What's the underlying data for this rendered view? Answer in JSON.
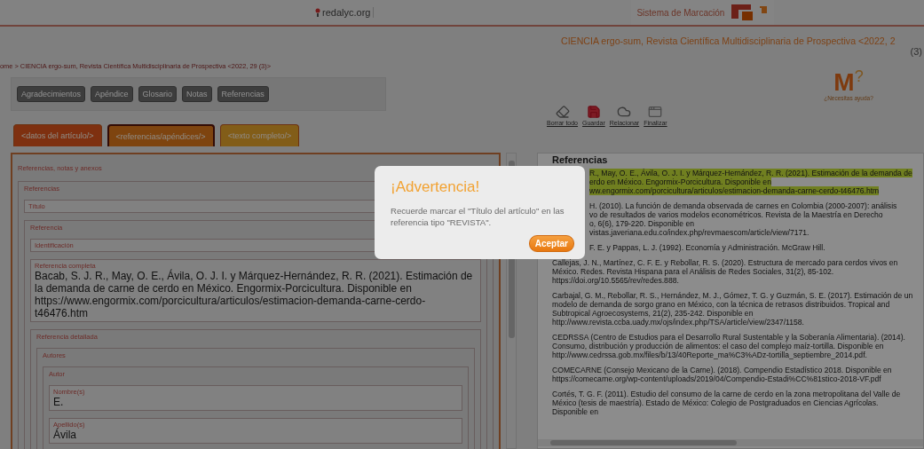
{
  "header": {
    "site_logo": "redalyc.org",
    "system_logo": "Sistema de Marcación"
  },
  "journal_title": "CIENCIA ergo-sum, Revista Científica Multidisciplinaria de Prospectiva <2022, 2",
  "journal_issue": "(3)",
  "breadcrumb": "ome > CIENCIA ergo-sum, Revista Científica Multidisciplinaria de Prospectiva <2022, 29 (3)>",
  "section_buttons": [
    "Agradecimientos",
    "Apéndice",
    "Glosario",
    "Notas",
    "Referencias"
  ],
  "help": {
    "letter": "M",
    "mark": "?",
    "caption": "¿Necesitas ayuda?"
  },
  "tabs": [
    {
      "label": "<datos del artículo/>",
      "selected": false
    },
    {
      "label": "<referencias/apéndices/>",
      "selected": true
    },
    {
      "label": "<texto completo/>",
      "selected": false
    }
  ],
  "toolbar": [
    {
      "kind": "erase",
      "label": "Borrar todo"
    },
    {
      "kind": "save",
      "label": "Guardar"
    },
    {
      "kind": "cloud",
      "label": "Relacionar"
    },
    {
      "kind": "window",
      "label": "Finalizar"
    }
  ],
  "form": {
    "panel": "Referencias, notas y anexos",
    "group": "Referencias",
    "title_field": "Título",
    "reference": "Referencia",
    "identification": "Identificación",
    "full_reference": {
      "label": "Referencia completa",
      "value": "Bacab, S. J. R., May, O. E., Ávila, O. J. I. y Márquez-Hernández, R. R. (2021). Estimación de la demanda de carne de cerdo en México. Engormix-Porcicultura. Disponible en https://www.engormix.com/porcicultura/articulos/estimacion-demanda-carne-cerdo-t46476.htm"
    },
    "detailed": "Referencia detallada",
    "authors": "Autores",
    "author": "Autor",
    "fields": [
      {
        "label": "Nombre(s)",
        "value": "E."
      },
      {
        "label": "Apellido(s)",
        "value": "Ávila"
      }
    ]
  },
  "references": {
    "heading": "Referencias",
    "items": [
      {
        "kind": "partial",
        "highlighted": true,
        "lines": [
          "R., May, O. E., Ávila, O. J. I. y Márquez-Hernández, R. R. (2021). Estimación de la demanda de",
          "erdo en México. Engormix-Porcicultura. Disponible en",
          "ww.engormix.com/porcicultura/articulos/estimacion-demanda-carne-cerdo-t46476.htm"
        ]
      },
      {
        "kind": "partial",
        "highlighted": false,
        "lines": [
          "H. (2010). La función de demanda observada de carnes en Colombia (2000-2007): análisis",
          "vo de resultados de varios modelos econométricos. Revista de la Maestría en Derecho",
          "o, 6(6), 179-220. Disponible en",
          "vistas.javeriana.edu.co/index.php/revmaescom/article/view/7171."
        ]
      },
      {
        "kind": "partial",
        "highlighted": false,
        "lines": [
          "F. E. y Pappas, L. J. (1992). Economía y Administración. McGraw Hill."
        ]
      },
      {
        "kind": "full",
        "highlighted": false,
        "lines": [
          "Callejas, J. N., Martínez, C. F. E. y Rebollar, R. S. (2020). Estructura de mercado para cerdos vivos en",
          "México. Redes. Revista Hispana para el Análisis de Redes Sociales, 31(2), 85-102.",
          "https://doi.org/10.5565/rev/redes.888."
        ]
      },
      {
        "kind": "full",
        "highlighted": false,
        "lines": [
          "Carbajal, G. M., Rebollar, R. S., Hernández, M. J., Gómez, T. G. y Guzmán, S. E. (2017). Estimación de un",
          "modelo de demanda de sorgo grano en México, con la técnica de retrasos distribuidos. Tropical and",
          "Subtropical Agroecosystems, 21(2), 235-242. Disponible en",
          "http://www.revista.ccba.uady.mx/ojs/index.php/TSA/article/view/2347/1158."
        ]
      },
      {
        "kind": "full",
        "highlighted": false,
        "lines": [
          "CEDRSSA (Centro de Estudios para el Desarrollo Rural Sustentable y la Soberanía Alimentaria). (2014).",
          "Consumo, distribución y producción de alimentos: el caso del complejo maíz-tortilla. Disponible en",
          "http://www.cedrssa.gob.mx/files/b/13/40Reporte_ma%C3%ADz-tortilla_septiembre_2014.pdf."
        ]
      },
      {
        "kind": "full",
        "highlighted": false,
        "lines": [
          "COMECARNE (Consejo Mexicano de la Carne). (2018). Compendio Estadístico 2018. Disponible en",
          "https://comecarne.org/wp-content/uploads/2019/04/Compendio-Estadi%CC%81stico-2018-VF.pdf"
        ]
      },
      {
        "kind": "full",
        "highlighted": false,
        "lines": [
          "Cortés, T. G. F. (2011). Estudio del consumo de la carne de cerdo en la zona metropolitana del Valle de",
          "México (tesis de maestría). Estado de México: Colegio de Postgraduados en Ciencias Agrícolas.",
          "Disponible en"
        ]
      }
    ]
  },
  "dialog": {
    "title": "¡Advertencia!",
    "message": "Recuerde marcar el \"Título del artículo\" en las referencia tipo \"REVISTA\".",
    "button": "Aceptar"
  }
}
